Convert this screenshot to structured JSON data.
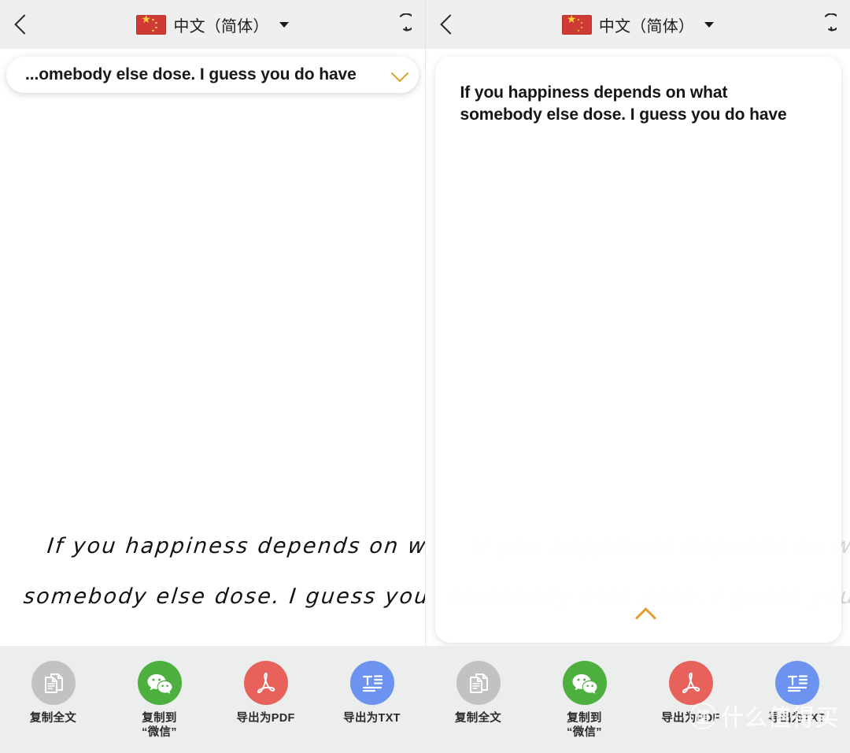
{
  "app": {
    "panes": [
      {
        "id": "left",
        "state": "collapsed"
      },
      {
        "id": "right",
        "state": "expanded"
      }
    ]
  },
  "topbar": {
    "back_icon": "chevron-left-icon",
    "flag_icon": "china-flag-icon",
    "language": "中文（简体）",
    "dropdown_icon": "caret-down-icon",
    "refresh_icon": "refresh-icon"
  },
  "left_pane": {
    "card": {
      "truncated_text": "...omebody else dose. I guess you do have",
      "expand_icon": "chevron-down-icon",
      "expand_icon_color": "#dca22e"
    },
    "handwriting": {
      "line1": "If you happiness depends on what",
      "line2": "somebody else dose. I guess you do have",
      "color": "#121212"
    }
  },
  "right_pane": {
    "card": {
      "full_text": "If you happiness depends on what\nsomebody else dose. I guess you do have",
      "collapse_icon": "chevron-up-icon",
      "collapse_icon_color": "#e49c2b"
    },
    "handwriting": {
      "line1": "If you happiness depends on what",
      "line2": "somebody else dose. I guess you do have",
      "color": "#d9d9d9"
    }
  },
  "toolbar": {
    "items": [
      {
        "label": "复制全文",
        "icon": "copy-documents-icon",
        "color": "#c2c2c2"
      },
      {
        "label": "复制到\n“微信”",
        "icon": "wechat-icon",
        "color": "#4caf3e"
      },
      {
        "label": "导出为PDF",
        "icon": "pdf-icon",
        "color": "#e8625c"
      },
      {
        "label": "导出为TXT",
        "icon": "txt-document-icon",
        "color": "#6b93ef"
      }
    ]
  },
  "watermark": {
    "badge": "值",
    "text": "什么值得买"
  }
}
